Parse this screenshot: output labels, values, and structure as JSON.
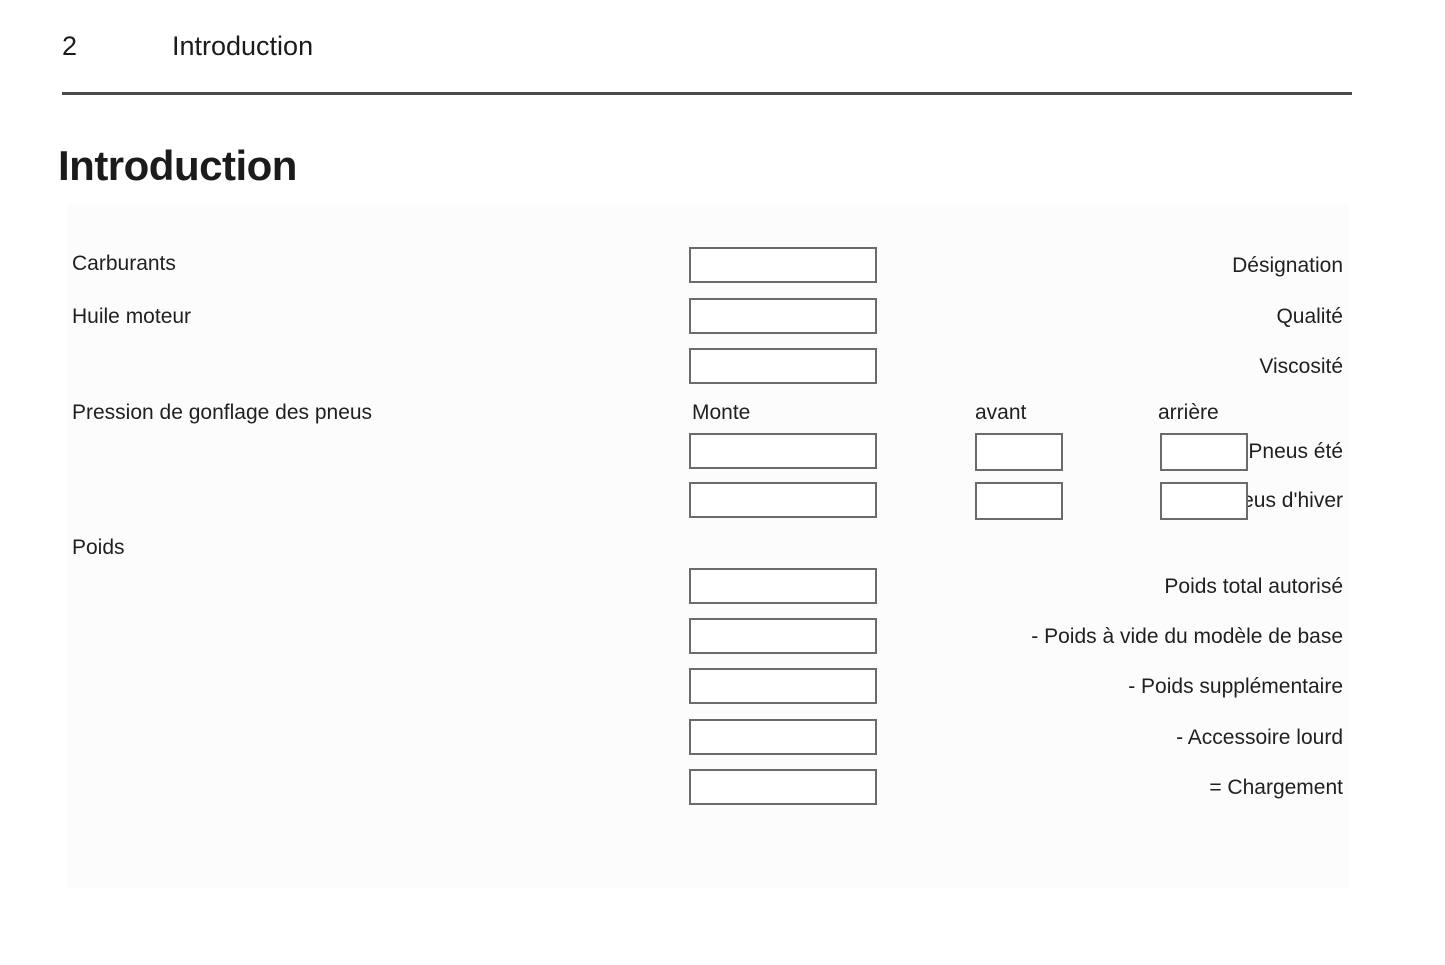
{
  "header": {
    "page_number": "2",
    "chapter": "Introduction"
  },
  "title": "Introduction",
  "panel": {
    "sections": [
      {
        "label": "Carburants"
      },
      {
        "label": "Huile moteur"
      },
      {
        "label": "Pression de gonflage des pneus"
      },
      {
        "label": "Poids"
      }
    ],
    "column_headers": {
      "mount": "Monte",
      "front": "avant",
      "rear": "arrière"
    },
    "fields": [
      {
        "caption": "Désignation",
        "value": ""
      },
      {
        "caption": "Qualité",
        "value": ""
      },
      {
        "caption": "Viscosité",
        "value": ""
      },
      {
        "caption": "Pneus été",
        "value": ""
      },
      {
        "caption": "Pneus d'hiver",
        "value": ""
      },
      {
        "caption": "Poids total autorisé",
        "value": ""
      },
      {
        "caption": "- Poids à vide du modèle de base",
        "value": ""
      },
      {
        "caption": "- Poids supplémentaire",
        "value": ""
      },
      {
        "caption": "- Accessoire lourd",
        "value": ""
      },
      {
        "caption": "= Chargement",
        "value": ""
      }
    ],
    "axle_fields": [
      {
        "row": "Pneus été",
        "front": "",
        "rear": ""
      },
      {
        "row": "Pneus d'hiver",
        "front": "",
        "rear": ""
      }
    ]
  },
  "colors": {
    "text": "#1b1b1b",
    "rule": "#4a4a4c",
    "box_border": "#6b6b6d",
    "panel_background": "#fcfcfc",
    "page_background": "#ffffff"
  }
}
